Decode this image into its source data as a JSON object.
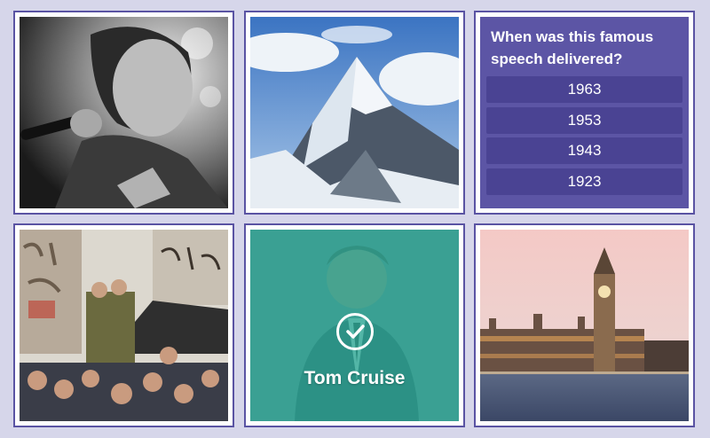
{
  "quiz": {
    "question": "When was this famous speech delivered?",
    "answers": [
      "1963",
      "1953",
      "1943",
      "1923"
    ]
  },
  "tiles": {
    "t1": {
      "icon": "singer-photo"
    },
    "t2": {
      "icon": "mountain-photo"
    },
    "t4": {
      "icon": "berlin-wall-photo"
    },
    "t5": {
      "icon": "actor-photo",
      "answer": "Tom Cruise",
      "status": "correct"
    },
    "t6": {
      "icon": "big-ben-photo"
    }
  },
  "colors": {
    "background": "#d6d6ea",
    "tile_border": "#5a53a3",
    "quiz_panel": "#5c55a5",
    "answer_button": "#4a4393",
    "correct_overlay": "#2fa896"
  }
}
